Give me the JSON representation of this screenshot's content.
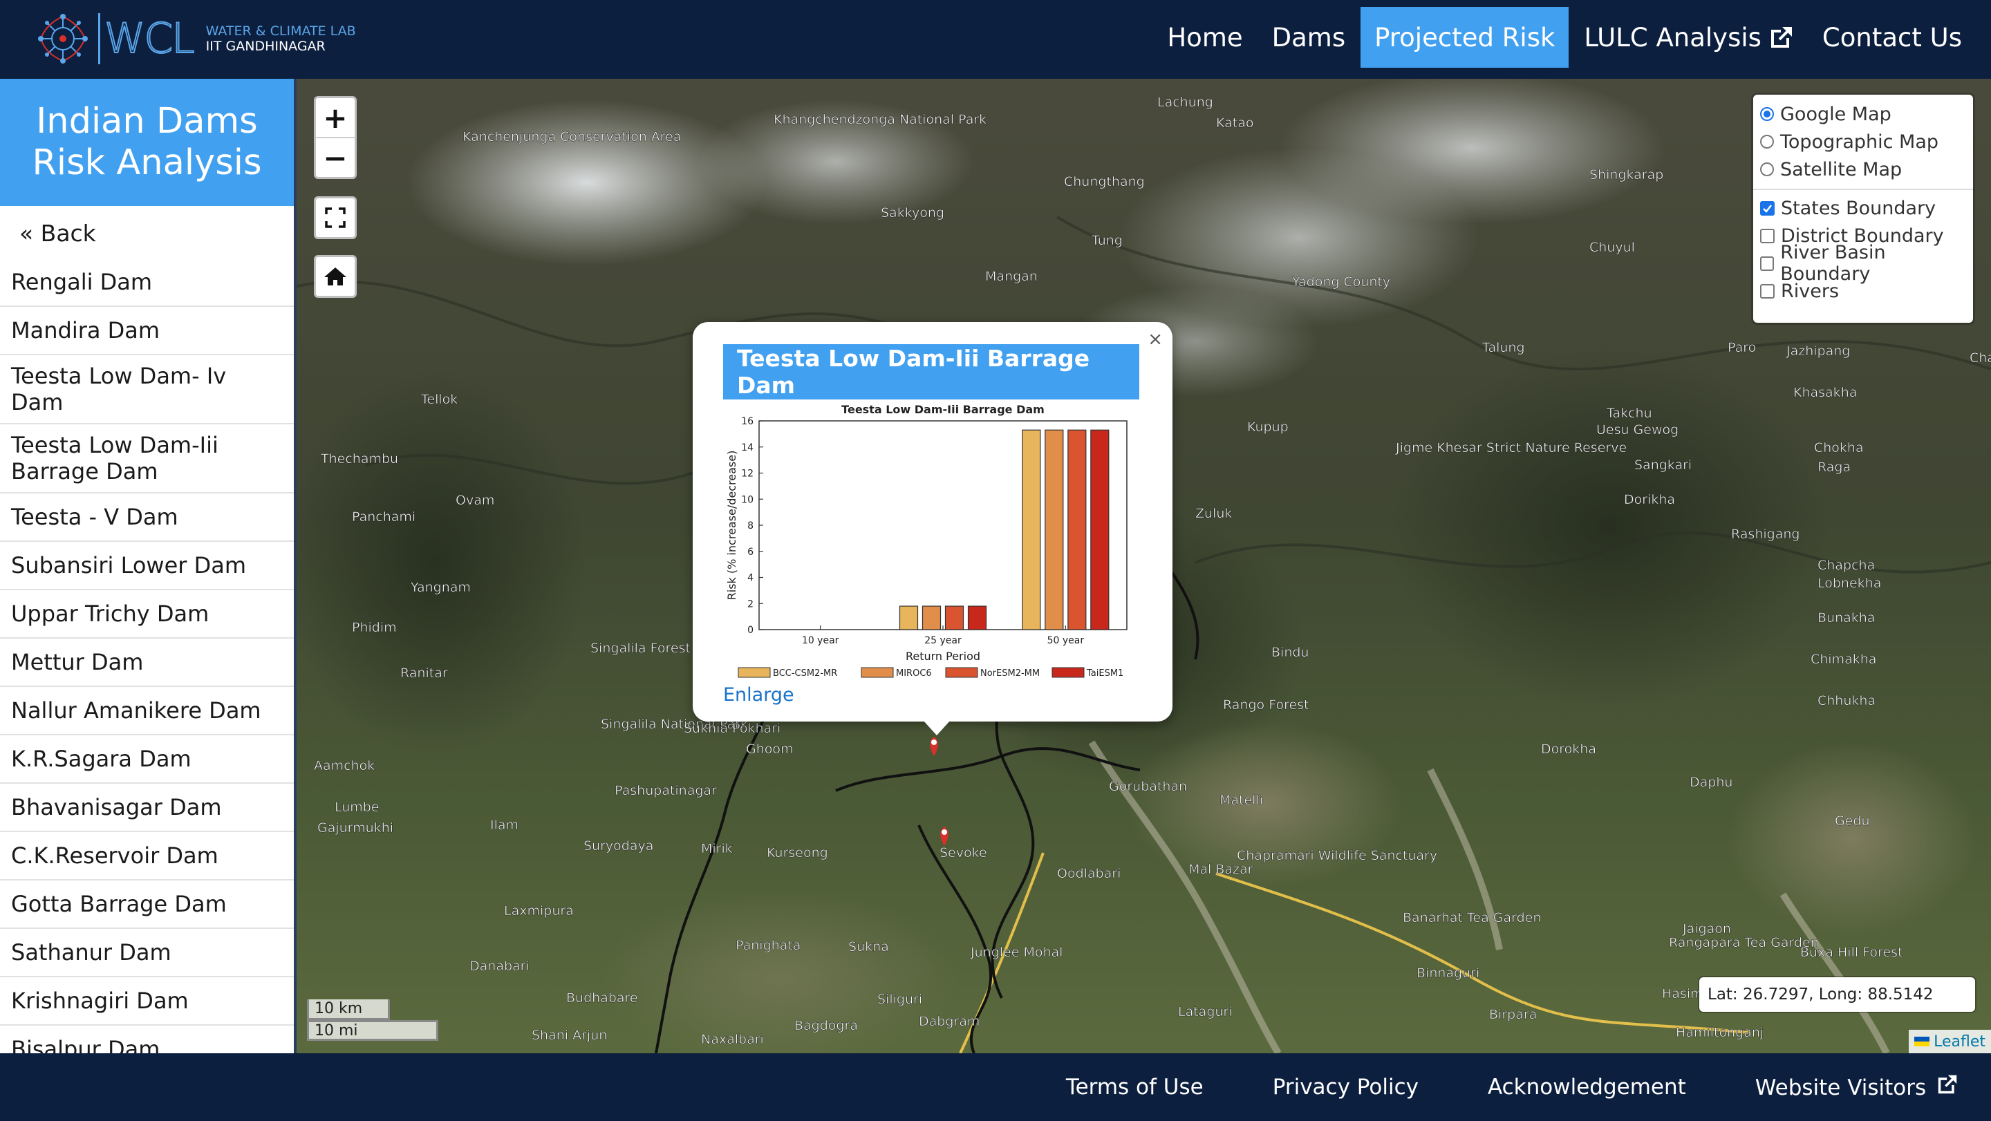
{
  "logo": {
    "line1": "WATER & CLIMATE LAB",
    "line2": "IIT GANDHINAGAR",
    "wordmark": "WCL"
  },
  "nav": {
    "items": [
      "Home",
      "Dams",
      "Projected Risk",
      "LULC Analysis",
      "Contact Us"
    ],
    "active": "Projected Risk"
  },
  "sidebar": {
    "title_line1": "Indian Dams",
    "title_line2": "Risk Analysis",
    "back": "« Back",
    "dams": [
      "Rengali Dam",
      "Mandira Dam",
      "Teesta Low Dam- Iv Dam",
      "Teesta Low Dam-Iii Barrage Dam",
      "Teesta - V Dam",
      "Subansiri Lower Dam",
      "Uppar Trichy Dam",
      "Mettur Dam",
      "Nallur Amanikere Dam",
      "K.R.Sagara Dam",
      "Bhavanisagar Dam",
      "C.K.Reservoir Dam",
      "Gotta Barrage Dam",
      "Sathanur Dam",
      "Krishnagiri Dam",
      "Bisalpur Dam"
    ]
  },
  "map": {
    "zoom_in": "+",
    "zoom_out": "−",
    "basemaps": [
      {
        "label": "Google Map",
        "checked": true
      },
      {
        "label": "Topographic Map",
        "checked": false
      },
      {
        "label": "Satellite Map",
        "checked": false
      }
    ],
    "overlays": [
      {
        "label": "States Boundary",
        "checked": true
      },
      {
        "label": "District Boundary",
        "checked": false
      },
      {
        "label": "River Basin Boundary",
        "checked": false
      },
      {
        "label": "Rivers",
        "checked": false
      }
    ],
    "scale_km": "10 km",
    "scale_mi": "10 mi",
    "coordinates": "Lat: 26.7297, Long: 88.5142",
    "attribution": "Leaflet",
    "place_labels": [
      "Kanchenjunga Conservation Area",
      "Khangchendzonga National Park",
      "Lachung",
      "Katao",
      "Chungthang",
      "Sakkyong",
      "Mangan",
      "Tung",
      "Shingkarap",
      "Chuyul",
      "Yadong County",
      "Jazhipang",
      "Paro",
      "Talung",
      "Khasakha",
      "Takchu",
      "Uesu Gewog",
      "Jigme Khesar Strict Nature Reserve",
      "Kupup",
      "Zuluk",
      "Chokha",
      "Raga",
      "Sangkari",
      "Dorikha",
      "Rashigang",
      "Chapcha",
      "Lobnekha",
      "Bunakha",
      "Chimakha",
      "Chhukha",
      "Tellok",
      "Thechambu",
      "Ovam",
      "Panchami",
      "Yangnam",
      "Phidim",
      "Ranitar",
      "Singalila Forest",
      "Singalila National Park",
      "Sukhia Pokhari",
      "Ghoom",
      "Pashupatinagar",
      "Bindu",
      "Rango Forest",
      "Gorubathan",
      "Matelli",
      "Dorokha",
      "Daphu",
      "Gedu",
      "Aamchok",
      "Lumbe",
      "Gajurmukhi",
      "Ilam",
      "Suryodaya",
      "Mirik",
      "Kurseong",
      "Siliguri",
      "Sevoke",
      "Oodlabari",
      "Mal Bazar",
      "Chapramari Wildlife Sanctuary",
      "Laxmipura",
      "Danabari",
      "Budhabare",
      "Shani Arjun",
      "Naxalbari",
      "Panighata",
      "Sukna",
      "Junglee Mohal",
      "Bagdogra",
      "Dabgram",
      "Lataguri",
      "Banarhat Tea Garden",
      "Binnaguri",
      "Birpara",
      "Jaigaon",
      "Rangapara Tea Garden",
      "Buxa Hill Forest",
      "Hamiltonganj",
      "Hasim",
      "Chang"
    ]
  },
  "popup": {
    "close": "×",
    "title": "Teesta Low Dam-Iii Barrage Dam",
    "enlarge": "Enlarge"
  },
  "chart_data": {
    "type": "bar",
    "title": "Teesta Low Dam-Iii Barrage Dam",
    "xlabel": "Return Period",
    "ylabel": "Risk (% increase/decrease)",
    "ylim": [
      0,
      16
    ],
    "yticks": [
      0,
      2,
      4,
      6,
      8,
      10,
      12,
      14,
      16
    ],
    "categories": [
      "10 year",
      "25 year",
      "50 year"
    ],
    "series": [
      {
        "name": "BCC-CSM2-MR",
        "color": "#e8b45c",
        "values": [
          0,
          1.8,
          15.3
        ]
      },
      {
        "name": "MIROC6",
        "color": "#e08e4a",
        "values": [
          0,
          1.8,
          15.3
        ]
      },
      {
        "name": "NorESM2-MM",
        "color": "#d9542f",
        "values": [
          0,
          1.8,
          15.3
        ]
      },
      {
        "name": "TaiESM1",
        "color": "#c8281c",
        "values": [
          0,
          1.8,
          15.3
        ]
      }
    ],
    "legend_position": "bottom",
    "grid": false
  },
  "footer": {
    "links": [
      "Terms of Use",
      "Privacy Policy",
      "Acknowledgement",
      "Website Visitors"
    ]
  },
  "colors": {
    "navy": "#0d1f3f",
    "accent": "#42a0f0",
    "marker": "#d9302a"
  }
}
